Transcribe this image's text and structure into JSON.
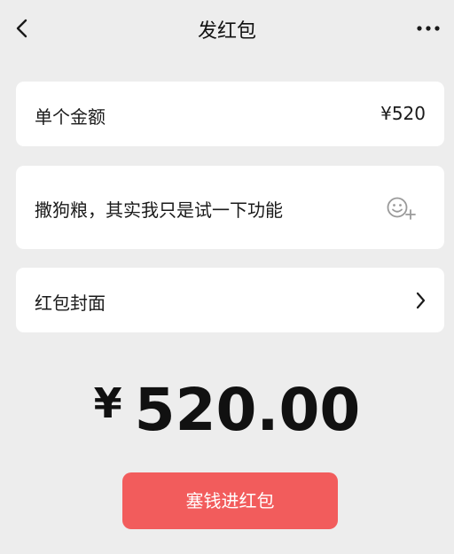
{
  "nav": {
    "title": "发红包",
    "back_icon": "chevron-left-icon",
    "more_icon": "more-dots-icon"
  },
  "amount_row": {
    "label": "单个金额",
    "value": "¥520"
  },
  "message_row": {
    "text": "撒狗粮，其实我只是试一下功能",
    "emoji_icon": "emoji-add-icon"
  },
  "cover_row": {
    "label": "红包封面",
    "icon": "chevron-right-icon"
  },
  "total": {
    "currency": "¥",
    "amount": "520.00"
  },
  "submit": {
    "label": "塞钱进红包"
  },
  "colors": {
    "background": "#ededed",
    "card": "#ffffff",
    "button": "#f25c5c",
    "text": "#1a1a1a"
  }
}
